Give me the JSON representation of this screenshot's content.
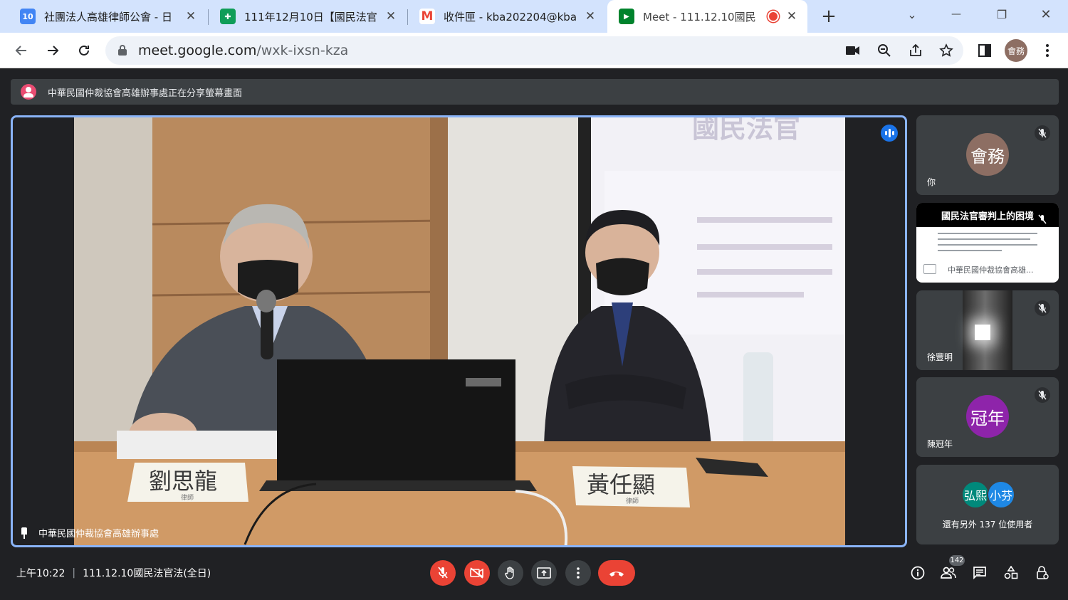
{
  "browser": {
    "tabs": [
      {
        "title": "社團法人高雄律師公會 - 日",
        "favicon_text": "10",
        "favicon_color": "#4285f4",
        "close": "✕"
      },
      {
        "title": "111年12月10日【國民法官",
        "favicon_text": "✚",
        "favicon_color": "#0f9d58",
        "close": "✕"
      },
      {
        "title": "收件匣 - kba202204@kba",
        "favicon_text": "M",
        "favicon_color": "#ffffff",
        "close": "✕"
      },
      {
        "title": "Meet - 111.12.10國民",
        "favicon_text": "▶",
        "favicon_color": "#00832d",
        "close": "✕"
      }
    ],
    "new_tab": "+",
    "window_controls": {
      "tab_search": "⌄",
      "minimize": "—",
      "restore": "❐",
      "close": "✕"
    },
    "url_host": "meet.google.com",
    "url_path": "/wxk-ixsn-kza",
    "profile_label": "會務"
  },
  "meet": {
    "share_banner": "中華民國仲裁協會高雄辦事處正在分享螢幕畫面",
    "main_tile_name": "中華民國仲裁協會高雄辦事處",
    "main_video": {
      "backdrop_text": "國民法官",
      "nameplate_left": "劉思龍",
      "nameplate_left_sub": "律師",
      "nameplate_right": "黃任顯",
      "nameplate_right_sub": "律師"
    },
    "side_tiles": {
      "self": {
        "avatar": "會務",
        "name": "你",
        "color": "#8d6e63"
      },
      "presentation": {
        "slide_title": "國民法官審判上的困境",
        "caption": "中華民國仲裁協會高雄..."
      },
      "camera": {
        "name": "徐豐明"
      },
      "guannian": {
        "avatar": "冠年",
        "name": "陳冠年",
        "color": "#8e24aa"
      },
      "others": {
        "avatars": [
          {
            "label": "弘熙",
            "color": "#00897b"
          },
          {
            "label": "小芬",
            "color": "#1e88e5"
          }
        ],
        "text": "還有另外 137 位使用者"
      }
    },
    "bottom": {
      "time": "上午10:22",
      "separator": "|",
      "meeting_title": "111.12.10國民法官法(全日)",
      "people_count": "142"
    }
  }
}
